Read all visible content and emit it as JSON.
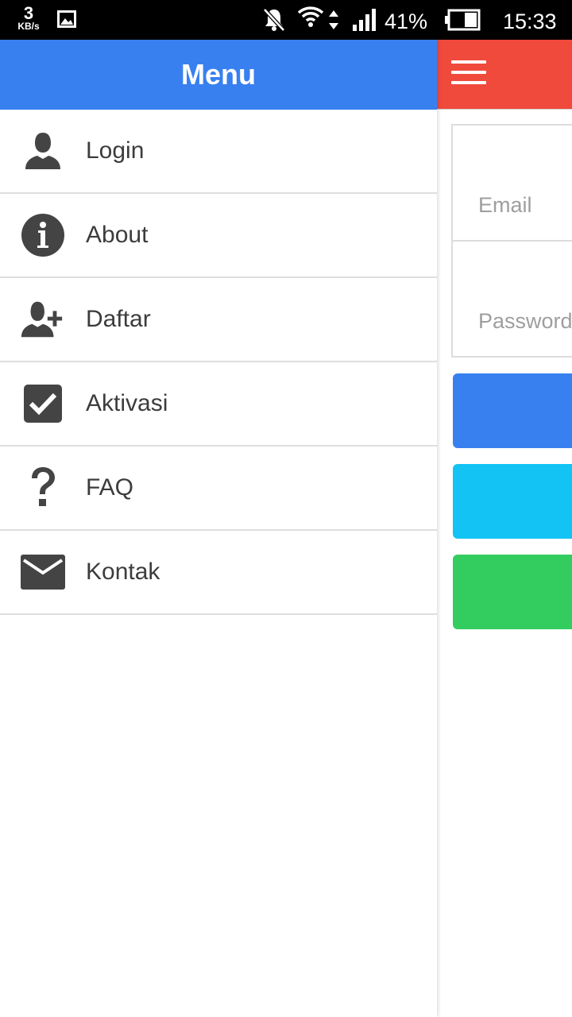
{
  "status_bar": {
    "net_speed": "3",
    "net_speed_unit": "KB/s",
    "battery_percent": "41%",
    "time": "15:33"
  },
  "drawer": {
    "title": "Menu",
    "items": [
      {
        "label": "Login",
        "icon": "person-icon"
      },
      {
        "label": "About",
        "icon": "info-icon"
      },
      {
        "label": "Daftar",
        "icon": "add-person-icon"
      },
      {
        "label": "Aktivasi",
        "icon": "checkbox-icon"
      },
      {
        "label": "FAQ",
        "icon": "question-icon"
      },
      {
        "label": "Kontak",
        "icon": "mail-icon"
      }
    ]
  },
  "login_form": {
    "email_placeholder": "Email",
    "password_placeholder": "Password"
  },
  "colors": {
    "drawer_header": "#3880f0",
    "page_header": "#f04a3c",
    "button_primary": "#3880f0",
    "button_info": "#12c3f4",
    "button_success": "#33cd5f",
    "icon": "#444444"
  }
}
